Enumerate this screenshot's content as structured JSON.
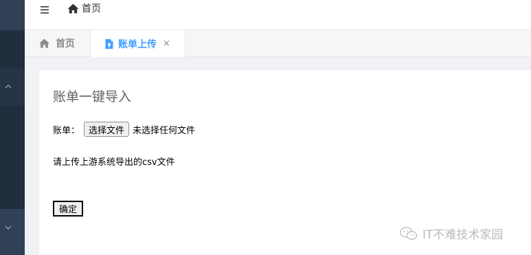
{
  "header": {
    "breadcrumb_label": "首页"
  },
  "tabs": [
    {
      "label": "首页",
      "icon": "home-icon",
      "active": false
    },
    {
      "label": "账单上传",
      "icon": "file-upload-icon",
      "active": true,
      "close": "×"
    }
  ],
  "card": {
    "title": "账单一键导入",
    "file_label": "账单：",
    "file_button": "选择文件",
    "file_status": "未选择任何文件",
    "hint": "请上传上游系统导出的csv文件",
    "submit": "确定"
  },
  "watermark": {
    "text": "IT不难技术家园",
    "icon": "wechat-icon"
  },
  "colors": {
    "sidebar": "#304156",
    "accent": "#409eff",
    "page_bg": "#f0f2f5"
  }
}
